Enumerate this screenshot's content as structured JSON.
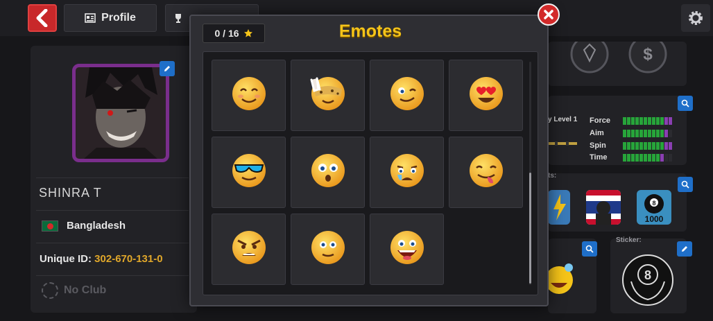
{
  "header": {
    "profile_tab": "Profile"
  },
  "player": {
    "name": "SHINRA T",
    "country": "Bangladesh",
    "unique_id_label": "Unique ID:",
    "unique_id_value": "302-670-131-0",
    "club": "No Club"
  },
  "side": {
    "level_label": "y Level 1",
    "stats": [
      {
        "name": "Force",
        "green": 10,
        "purple": 2
      },
      {
        "name": "Aim",
        "green": 10,
        "purple": 1
      },
      {
        "name": "Spin",
        "green": 10,
        "purple": 2
      },
      {
        "name": "Time",
        "green": 9,
        "purple": 1
      }
    ],
    "achievements_label": "ts:",
    "achievement_badge": "1000",
    "sticker_label": "Sticker:"
  },
  "modal": {
    "counter": "0 / 16",
    "title": "Emotes",
    "emotes": [
      "smiling-face-with-smiling-eyes",
      "face-with-victory-hand-and-leopard-mask",
      "winking-face",
      "smiling-face-with-heart-eyes",
      "smiling-face-with-sunglasses",
      "flushed-face",
      "crying-face",
      "face-savoring-food",
      "angry-face",
      "face-with-open-eyes",
      "grinning-face-big-eyes"
    ]
  },
  "colors": {
    "title_yellow": "#f5c419",
    "close_red": "#d22a2a",
    "accent_blue": "#1f6fc9",
    "id_gold": "#e0a72a"
  }
}
